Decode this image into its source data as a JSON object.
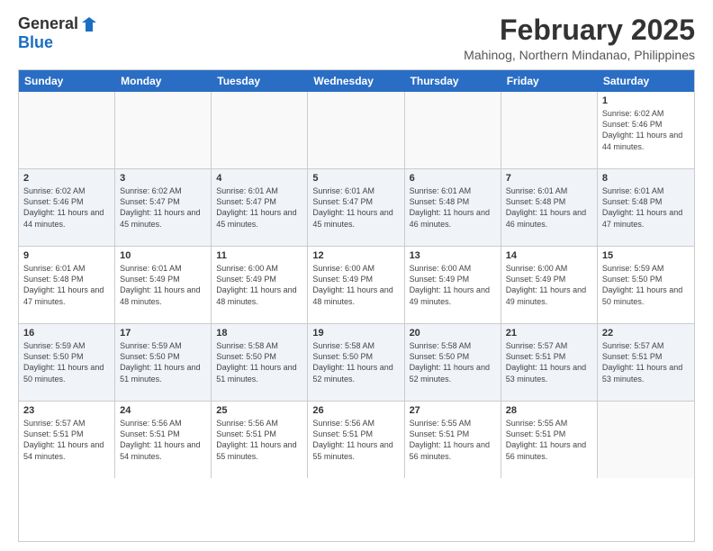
{
  "logo": {
    "general": "General",
    "blue": "Blue"
  },
  "title": {
    "month_year": "February 2025",
    "location": "Mahinog, Northern Mindanao, Philippines"
  },
  "calendar": {
    "headers": [
      "Sunday",
      "Monday",
      "Tuesday",
      "Wednesday",
      "Thursday",
      "Friday",
      "Saturday"
    ],
    "rows": [
      [
        {
          "day": "",
          "info": ""
        },
        {
          "day": "",
          "info": ""
        },
        {
          "day": "",
          "info": ""
        },
        {
          "day": "",
          "info": ""
        },
        {
          "day": "",
          "info": ""
        },
        {
          "day": "",
          "info": ""
        },
        {
          "day": "1",
          "info": "Sunrise: 6:02 AM\nSunset: 5:46 PM\nDaylight: 11 hours and 44 minutes."
        }
      ],
      [
        {
          "day": "2",
          "info": "Sunrise: 6:02 AM\nSunset: 5:46 PM\nDaylight: 11 hours and 44 minutes."
        },
        {
          "day": "3",
          "info": "Sunrise: 6:02 AM\nSunset: 5:47 PM\nDaylight: 11 hours and 45 minutes."
        },
        {
          "day": "4",
          "info": "Sunrise: 6:01 AM\nSunset: 5:47 PM\nDaylight: 11 hours and 45 minutes."
        },
        {
          "day": "5",
          "info": "Sunrise: 6:01 AM\nSunset: 5:47 PM\nDaylight: 11 hours and 45 minutes."
        },
        {
          "day": "6",
          "info": "Sunrise: 6:01 AM\nSunset: 5:48 PM\nDaylight: 11 hours and 46 minutes."
        },
        {
          "day": "7",
          "info": "Sunrise: 6:01 AM\nSunset: 5:48 PM\nDaylight: 11 hours and 46 minutes."
        },
        {
          "day": "8",
          "info": "Sunrise: 6:01 AM\nSunset: 5:48 PM\nDaylight: 11 hours and 47 minutes."
        }
      ],
      [
        {
          "day": "9",
          "info": "Sunrise: 6:01 AM\nSunset: 5:48 PM\nDaylight: 11 hours and 47 minutes."
        },
        {
          "day": "10",
          "info": "Sunrise: 6:01 AM\nSunset: 5:49 PM\nDaylight: 11 hours and 48 minutes."
        },
        {
          "day": "11",
          "info": "Sunrise: 6:00 AM\nSunset: 5:49 PM\nDaylight: 11 hours and 48 minutes."
        },
        {
          "day": "12",
          "info": "Sunrise: 6:00 AM\nSunset: 5:49 PM\nDaylight: 11 hours and 48 minutes."
        },
        {
          "day": "13",
          "info": "Sunrise: 6:00 AM\nSunset: 5:49 PM\nDaylight: 11 hours and 49 minutes."
        },
        {
          "day": "14",
          "info": "Sunrise: 6:00 AM\nSunset: 5:49 PM\nDaylight: 11 hours and 49 minutes."
        },
        {
          "day": "15",
          "info": "Sunrise: 5:59 AM\nSunset: 5:50 PM\nDaylight: 11 hours and 50 minutes."
        }
      ],
      [
        {
          "day": "16",
          "info": "Sunrise: 5:59 AM\nSunset: 5:50 PM\nDaylight: 11 hours and 50 minutes."
        },
        {
          "day": "17",
          "info": "Sunrise: 5:59 AM\nSunset: 5:50 PM\nDaylight: 11 hours and 51 minutes."
        },
        {
          "day": "18",
          "info": "Sunrise: 5:58 AM\nSunset: 5:50 PM\nDaylight: 11 hours and 51 minutes."
        },
        {
          "day": "19",
          "info": "Sunrise: 5:58 AM\nSunset: 5:50 PM\nDaylight: 11 hours and 52 minutes."
        },
        {
          "day": "20",
          "info": "Sunrise: 5:58 AM\nSunset: 5:50 PM\nDaylight: 11 hours and 52 minutes."
        },
        {
          "day": "21",
          "info": "Sunrise: 5:57 AM\nSunset: 5:51 PM\nDaylight: 11 hours and 53 minutes."
        },
        {
          "day": "22",
          "info": "Sunrise: 5:57 AM\nSunset: 5:51 PM\nDaylight: 11 hours and 53 minutes."
        }
      ],
      [
        {
          "day": "23",
          "info": "Sunrise: 5:57 AM\nSunset: 5:51 PM\nDaylight: 11 hours and 54 minutes."
        },
        {
          "day": "24",
          "info": "Sunrise: 5:56 AM\nSunset: 5:51 PM\nDaylight: 11 hours and 54 minutes."
        },
        {
          "day": "25",
          "info": "Sunrise: 5:56 AM\nSunset: 5:51 PM\nDaylight: 11 hours and 55 minutes."
        },
        {
          "day": "26",
          "info": "Sunrise: 5:56 AM\nSunset: 5:51 PM\nDaylight: 11 hours and 55 minutes."
        },
        {
          "day": "27",
          "info": "Sunrise: 5:55 AM\nSunset: 5:51 PM\nDaylight: 11 hours and 56 minutes."
        },
        {
          "day": "28",
          "info": "Sunrise: 5:55 AM\nSunset: 5:51 PM\nDaylight: 11 hours and 56 minutes."
        },
        {
          "day": "",
          "info": ""
        }
      ]
    ]
  }
}
